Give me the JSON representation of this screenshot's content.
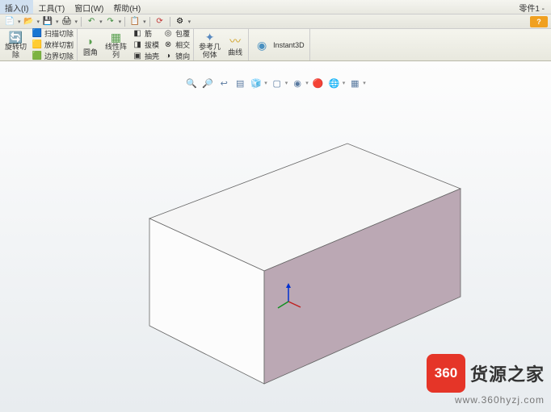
{
  "menu": {
    "insert": "插入(I)",
    "tools": "工具(T)",
    "window": "窗口(W)",
    "help": "帮助(H)"
  },
  "title_right": "零件1 -",
  "quick": {
    "help": "?"
  },
  "ribbon": {
    "rotate_cut": "旋转切\n除",
    "sweep_cut": "扫描切除",
    "loft_cut": "放样切割",
    "boundary_cut": "边界切除",
    "fillet": "圆角",
    "linear_pattern": "线性阵\n列",
    "rib": "筋",
    "draft": "拔模",
    "shell": "抽壳",
    "wrap": "包覆",
    "intersect": "相交",
    "mirror": "镜向",
    "ref_geom": "参考几\n何体",
    "curves": "曲线",
    "instant3d": "Instant3D"
  },
  "watermark": {
    "badge": "360",
    "text": "货源之家",
    "url": "www.360hyzj.com"
  }
}
